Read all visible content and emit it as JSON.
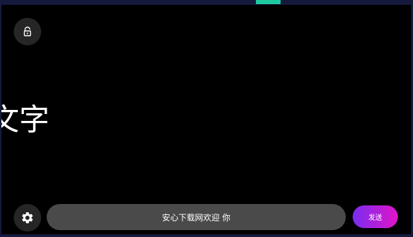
{
  "colors": {
    "background": "#000000",
    "frame": "#151a3d",
    "accent": "#1ec9a0",
    "button_bg": "#262626",
    "input_bg": "#4a4a4a",
    "send_gradient_start": "#7a2df0",
    "send_gradient_end": "#e014c8"
  },
  "icons": {
    "lock": "lock-open-icon",
    "settings": "gear-icon"
  },
  "display": {
    "scrolling_text": "文字"
  },
  "composer": {
    "input_value": "安心下载网欢迎 你",
    "send_label": "发送"
  }
}
